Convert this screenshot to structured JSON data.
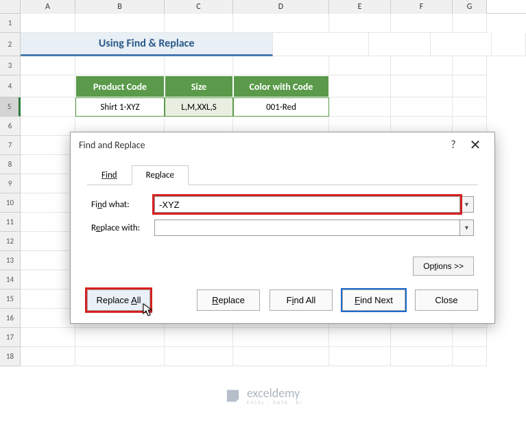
{
  "columns": [
    "A",
    "B",
    "C",
    "D",
    "E",
    "F",
    "G"
  ],
  "row_count": 18,
  "selected_row": 5,
  "title": "Using Find & Replace",
  "table": {
    "headers": [
      "Product Code",
      "Size",
      "Color with Code"
    ],
    "rows": [
      [
        "Shirt 1-XYZ",
        "L,M,XXL,S",
        "001-Red"
      ]
    ]
  },
  "dialog": {
    "title": "Find and Replace",
    "help": "?",
    "close": "✕",
    "tabs": {
      "find": "Find",
      "replace": "Replace"
    },
    "find_label": "Find what:",
    "find_value": "-XYZ",
    "replace_label": "Replace with:",
    "replace_value": "",
    "options_btn": "Options >>",
    "buttons": {
      "replace_all": "Replace All",
      "replace": "Replace",
      "find_all": "Find All",
      "find_next": "Find Next",
      "close": "Close"
    }
  },
  "watermark": {
    "name": "exceldemy",
    "sub": "EXCEL · DATA · BI"
  }
}
